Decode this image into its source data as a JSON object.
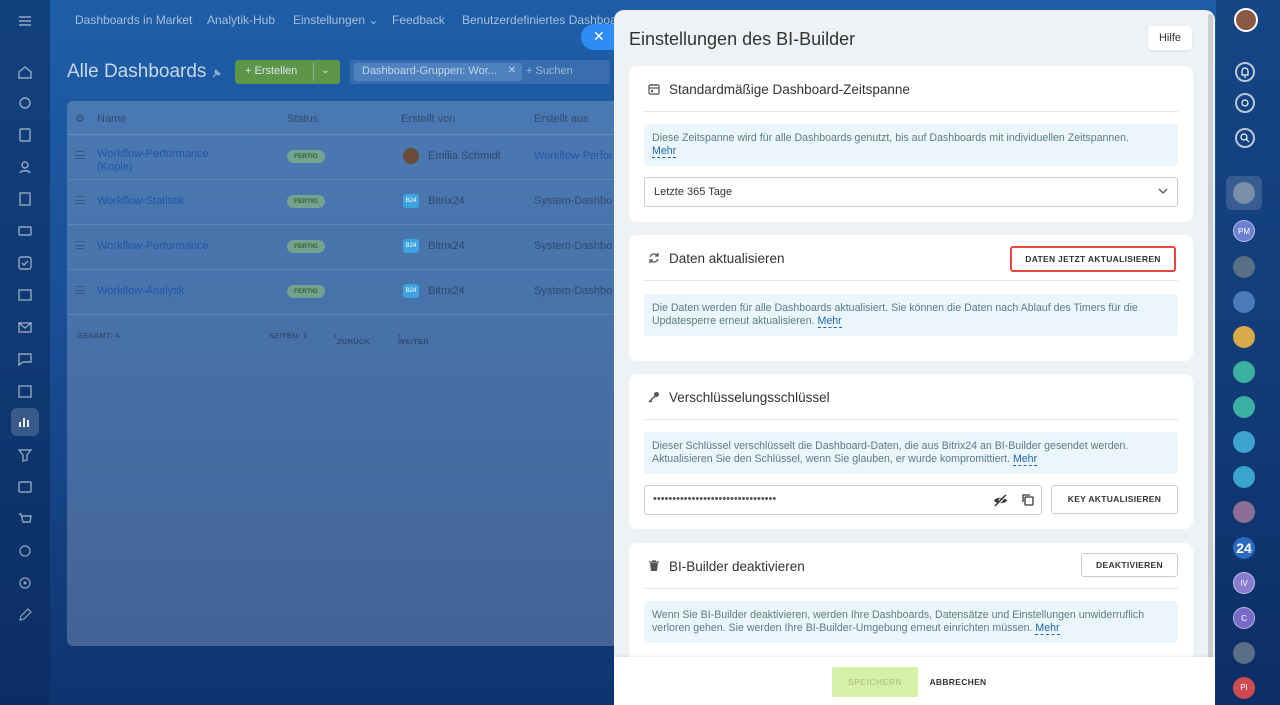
{
  "topnav": {
    "items": [
      "Dashboards in Market",
      "Analytik-Hub",
      "Einstellungen",
      "Feedback",
      "Benutzerdefiniertes Dashboa"
    ]
  },
  "page": {
    "title": "Alle Dashboards",
    "create_label": "+ Erstellen",
    "filter_chip": "Dashboard-Gruppen: Wor...",
    "search_placeholder": "+ Suchen"
  },
  "grid": {
    "columns": [
      "Name",
      "Status",
      "Erstellt von",
      "Erstellt aus"
    ],
    "rows": [
      {
        "name": "Workflow-Performance (Kopie)",
        "status": "FERTIG",
        "creator": "Emilia Schmidt",
        "source": "Workflow-Perfor"
      },
      {
        "name": "Workflow-Statistik",
        "status": "FERTIG",
        "creator": "Bitrix24",
        "source": "System-Dashbo"
      },
      {
        "name": "Workflow-Performance",
        "status": "FERTIG",
        "creator": "Bitrix24",
        "source": "System-Dashbo"
      },
      {
        "name": "Workflow-Analytik",
        "status": "FERTIG",
        "creator": "Bitrix24",
        "source": "System-Dashbo"
      }
    ],
    "footer": {
      "total": "GESAMT: 4",
      "pages": "SEITEN: 1",
      "prev": "ZURÜCK",
      "next": "WEITER"
    }
  },
  "right_rail": {
    "avatars": [
      "PM",
      "24",
      "IV",
      "C",
      "PI"
    ]
  },
  "slider": {
    "title": "Einstellungen des BI-Builder",
    "help_label": "Hilfe",
    "period": {
      "title": "Standardmäßige Dashboard-Zeitspanne",
      "hint": "Diese Zeitspanne wird für alle Dashboards genutzt, bis auf Dashboards mit individuellen Zeitspannen.",
      "more": "Mehr",
      "selected": "Letzte 365 Tage"
    },
    "refresh": {
      "title": "Daten aktualisieren",
      "button": "DATEN JETZT AKTUALISIEREN",
      "hint": "Die Daten werden für alle Dashboards aktualisiert. Sie können die Daten nach Ablauf des Timers für die Updatesperre erneut aktualisieren.",
      "more": "Mehr"
    },
    "key": {
      "title": "Verschlüsselungsschlüssel",
      "hint": "Dieser Schlüssel verschlüsselt die Dashboard-Daten, die aus Bitrix24 an BI-Builder gesendet werden. Aktualisieren Sie den Schlüssel, wenn Sie glauben, er wurde kompromittiert.",
      "more": "Mehr",
      "value": "••••••••••••••••••••••••••••••••",
      "button": "KEY AKTUALISIEREN"
    },
    "deactivate": {
      "title": "BI-Builder deaktivieren",
      "button": "DEAKTIVIEREN",
      "hint": "Wenn Sie BI-Builder deaktivieren, werden Ihre Dashboards, Datensätze und Einstellungen unwiderruflich verloren gehen. Sie werden Ihre BI-Builder-Umgebung erneut einrichten müssen.",
      "more": "Mehr"
    },
    "footer": {
      "save": "SPEICHERN",
      "cancel": "ABBRECHEN"
    }
  },
  "colors": {
    "accent": "#2f8cf5",
    "highlight": "#e8473f",
    "save_disabled": "#d7f0a8",
    "link": "#2067b0"
  }
}
